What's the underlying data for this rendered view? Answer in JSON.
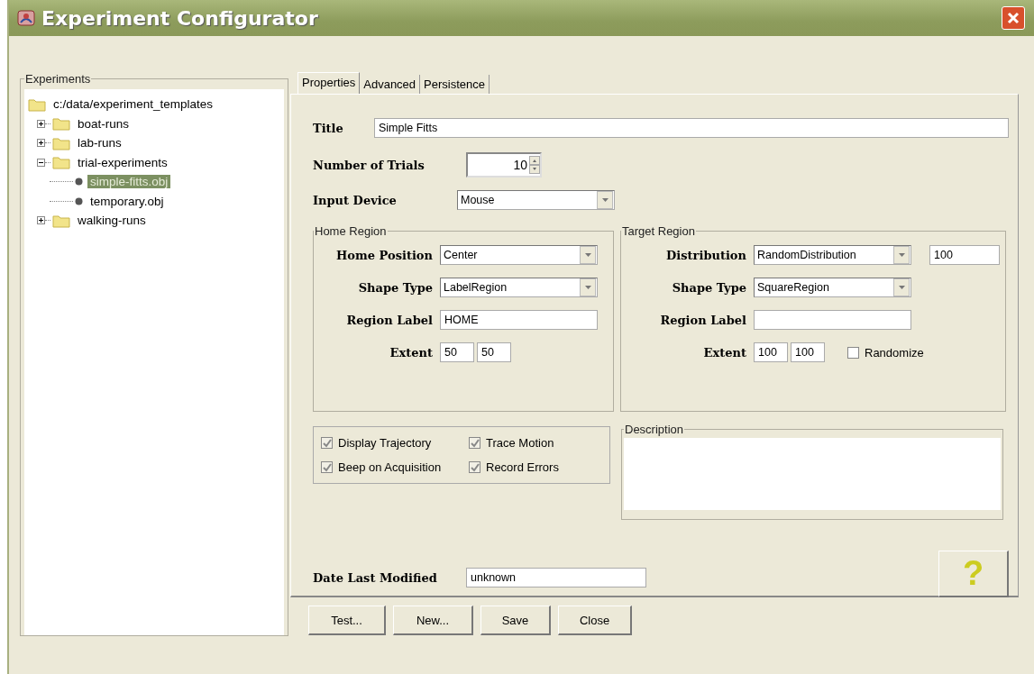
{
  "window": {
    "title": "Experiment Configurator"
  },
  "experiments": {
    "legend": "Experiments",
    "tree": [
      {
        "label": "c:/data/experiment_templates",
        "kind": "folder",
        "selected": false,
        "children": [
          {
            "label": "boat-runs",
            "kind": "folder",
            "expanded": false,
            "selected": false
          },
          {
            "label": "lab-runs",
            "kind": "folder",
            "expanded": false,
            "selected": false
          },
          {
            "label": "trial-experiments",
            "kind": "folder",
            "expanded": true,
            "selected": false,
            "children": [
              {
                "label": "simple-fitts.obj",
                "kind": "file",
                "selected": true
              },
              {
                "label": "temporary.obj",
                "kind": "file",
                "selected": false
              }
            ]
          },
          {
            "label": "walking-runs",
            "kind": "folder",
            "expanded": false,
            "selected": false
          }
        ]
      }
    ]
  },
  "tabs": [
    {
      "label": "Properties",
      "selected": true
    },
    {
      "label": "Advanced",
      "selected": false
    },
    {
      "label": "Persistence",
      "selected": false
    }
  ],
  "title": {
    "label": "Title",
    "value": "Simple Fitts"
  },
  "trials": {
    "label": "Number of Trials",
    "value": "10"
  },
  "input_device": {
    "label": "Input Device",
    "value": "Mouse"
  },
  "home_region": {
    "legend": "Home Region",
    "rows": [
      {
        "kind": "select",
        "label": "Home Position",
        "value": "Center"
      },
      {
        "kind": "select",
        "label": "Shape Type",
        "value": "LabelRegion"
      },
      {
        "kind": "text",
        "label": "Region Label",
        "value": "HOME"
      },
      {
        "kind": "extent",
        "label": "Extent",
        "values": [
          "50",
          "50"
        ]
      }
    ]
  },
  "target_region": {
    "legend": "Target Region",
    "rows": [
      {
        "kind": "select",
        "label": "Distribution",
        "value": "RandomDistribution",
        "extra": "100"
      },
      {
        "kind": "select",
        "label": "Shape Type",
        "value": "SquareRegion"
      },
      {
        "kind": "text",
        "label": "Region Label"
      },
      {
        "kind": "extent",
        "label": "Extent",
        "values": [
          "100",
          "100"
        ],
        "checkbox": {
          "label": "Randomize",
          "checked": false
        }
      }
    ]
  },
  "options": [
    {
      "label": "Display Trajectory",
      "checked": true
    },
    {
      "label": "Trace Motion",
      "checked": true
    },
    {
      "label": "Beep on Acquisition",
      "checked": true
    },
    {
      "label": "Record Errors",
      "checked": true
    }
  ],
  "description": {
    "legend": "Description"
  },
  "date_modified": {
    "label": "Date Last Modified",
    "value": "unknown"
  },
  "help": {
    "symbol": "?"
  },
  "buttons": [
    "Test...",
    "New...",
    "Save",
    "Close"
  ]
}
